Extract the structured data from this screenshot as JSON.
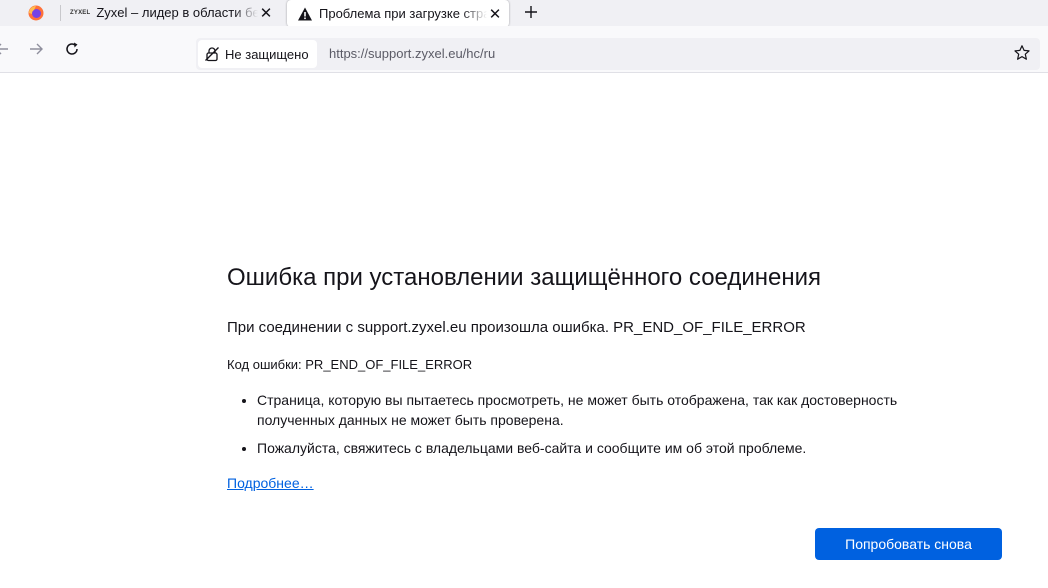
{
  "tabs": [
    {
      "title": "Zyxel – лидер в области безопасности",
      "logo": "ZYXEL",
      "icon": "zyxel-favicon"
    },
    {
      "title": "Проблема при загрузке страницы",
      "icon": "warning-icon",
      "active": true
    }
  ],
  "navbar": {
    "security_label": "Не защищено",
    "url": "https://support.zyxel.eu/hc/ru"
  },
  "error": {
    "title": "Ошибка при установлении защищённого соединения",
    "short_desc": "При соединении с support.zyxel.eu произошла ошибка. PR_END_OF_FILE_ERROR",
    "code_line": "Код ошибки: PR_END_OF_FILE_ERROR",
    "bullets": [
      "Страница, которую вы пытаетесь просмотреть, не может быть отображена, так как достоверность полученных данных не может быть проверена.",
      "Пожалуйста, свяжитесь с владельцами веб-сайта и сообщите им об этой проблеме."
    ],
    "learn_more": "Подробнее…",
    "retry_button": "Попробовать снова"
  },
  "colors": {
    "accent": "#0061e0",
    "tabbar_bg": "#f0f0f4",
    "navbar_bg": "#f9f9fb"
  }
}
